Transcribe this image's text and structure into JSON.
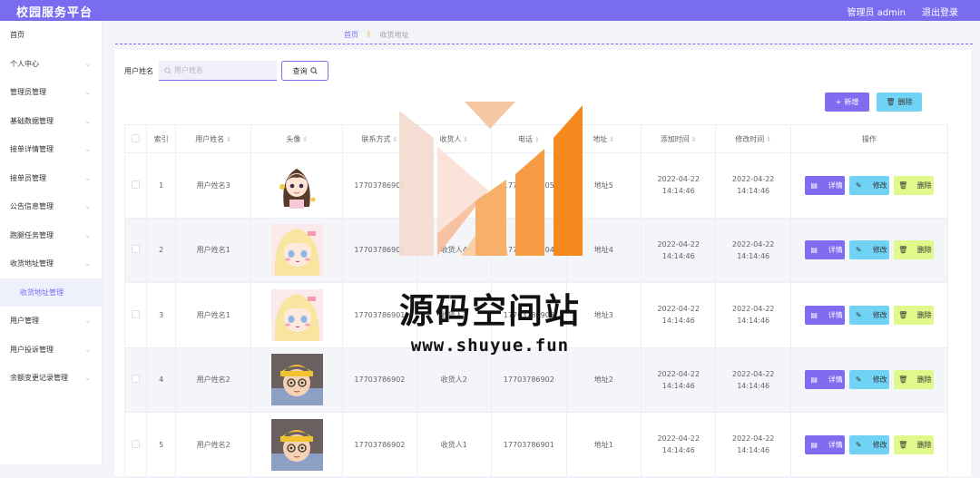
{
  "header": {
    "title": "校园服务平台",
    "user": "管理员 admin",
    "logout": "退出登录"
  },
  "sidebar": {
    "items": [
      {
        "label": "首页",
        "chevron": false
      },
      {
        "label": "个人中心",
        "chevron": true
      },
      {
        "label": "管理员管理",
        "chevron": true
      },
      {
        "label": "基础数据管理",
        "chevron": true
      },
      {
        "label": "接单详情管理",
        "chevron": true
      },
      {
        "label": "接单员管理",
        "chevron": true
      },
      {
        "label": "公告信息管理",
        "chevron": true
      },
      {
        "label": "跑腿任务管理",
        "chevron": true
      },
      {
        "label": "收货地址管理",
        "chevron": true
      },
      {
        "label": "收货地址管理",
        "chevron": false,
        "sub": true
      },
      {
        "label": "用户管理",
        "chevron": true
      },
      {
        "label": "用户投诉管理",
        "chevron": true
      },
      {
        "label": "余额变更记录管理",
        "chevron": true
      }
    ]
  },
  "breadcrumb": {
    "home": "首页",
    "current": "收货地址"
  },
  "search": {
    "label": "用户姓名",
    "placeholder": "用户姓名",
    "button": "查询"
  },
  "actions": {
    "add": "新增",
    "delete": "删除"
  },
  "table": {
    "columns": [
      "索引",
      "用户姓名",
      "头像",
      "联系方式",
      "收货人",
      "电话",
      "地址",
      "添加时间",
      "修改时间",
      "操作"
    ],
    "rows": [
      {
        "index": "1",
        "name": "用户姓名3",
        "avatar": "girl-brown-hair",
        "contact": "17703786902",
        "receiver": "收货人5",
        "phone": "17703786905",
        "address": "地址5",
        "added": "2022-04-22 14:14:46",
        "modified": "2022-04-22 14:14:46"
      },
      {
        "index": "2",
        "name": "用户姓名1",
        "avatar": "girl-blonde-hair",
        "contact": "17703786901",
        "receiver": "收货人4",
        "phone": "17703786904",
        "address": "地址4",
        "added": "2022-04-22 14:14:46",
        "modified": "2022-04-22 14:14:46"
      },
      {
        "index": "3",
        "name": "用户姓名1",
        "avatar": "girl-blonde-hair",
        "contact": "17703786901",
        "receiver": "收货人3",
        "phone": "17703786903",
        "address": "地址3",
        "added": "2022-04-22 14:14:46",
        "modified": "2022-04-22 14:14:46"
      },
      {
        "index": "4",
        "name": "用户姓名2",
        "avatar": "boy-yellow-hat",
        "contact": "17703786902",
        "receiver": "收货人2",
        "phone": "17703786902",
        "address": "地址2",
        "added": "2022-04-22 14:14:46",
        "modified": "2022-04-22 14:14:46"
      },
      {
        "index": "5",
        "name": "用户姓名2",
        "avatar": "boy-yellow-hat",
        "contact": "17703786902",
        "receiver": "收货人1",
        "phone": "17703786901",
        "address": "地址1",
        "added": "2022-04-22 14:14:46",
        "modified": "2022-04-22 14:14:46"
      }
    ],
    "row_actions": {
      "detail": "详情",
      "edit": "修改",
      "delete": "删除"
    }
  },
  "watermark": {
    "text": "源码空间站",
    "url": "www.shuyue.fun"
  },
  "colors": {
    "primary": "#7a6cf0",
    "cyan": "#70d3f5",
    "lime": "#dff98b",
    "orange": "#f5891e"
  }
}
